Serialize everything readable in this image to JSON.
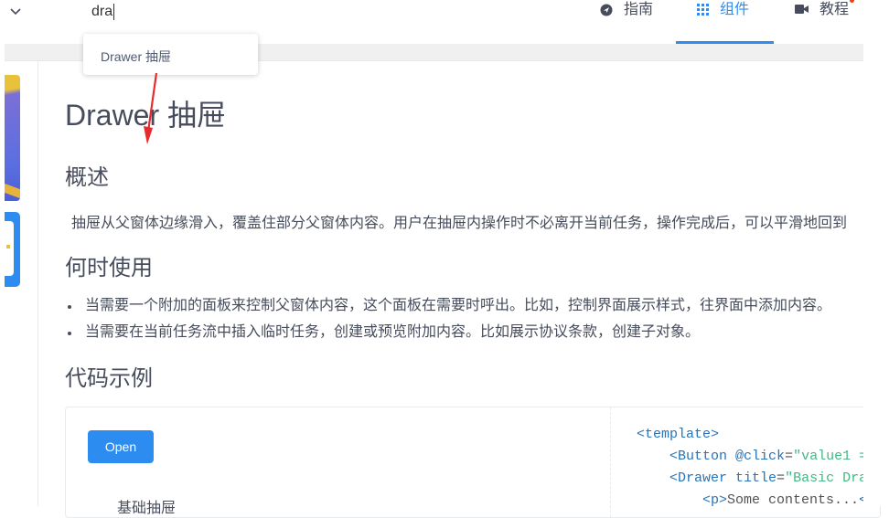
{
  "header": {
    "search_value": "dra",
    "nav": [
      {
        "label": "指南",
        "icon": "compass-icon",
        "active": false
      },
      {
        "label": "组件",
        "icon": "grid-icon",
        "active": true
      },
      {
        "label": "教程",
        "icon": "video-icon",
        "active": false
      }
    ]
  },
  "dropdown": {
    "items": [
      "Drawer 抽屉"
    ]
  },
  "content": {
    "title": "Drawer 抽屉",
    "overview_heading": "概述",
    "overview_text": "抽屉从父窗体边缘滑入，覆盖住部分父窗体内容。用户在抽屉内操作时不必离开当前任务，操作完成后，可以平滑地回到",
    "when_heading": "何时使用",
    "when_items": [
      "当需要一个附加的面板来控制父窗体内容，这个面板在需要时呼出。比如，控制界面展示样式，往界面中添加内容。",
      "当需要在当前任务流中插入临时任务，创建或预览附加内容。比如展示协议条款，创建子对象。"
    ],
    "examples_heading": "代码示例"
  },
  "demo": {
    "button_label": "Open",
    "caption": "基础抽屉",
    "code": {
      "line1": "<template>",
      "line2_tag": "<Button ",
      "line2_attr": "@click",
      "line2_eq": "=",
      "line2_str": "\"value1 =",
      "line3_tag": "<Drawer ",
      "line3_attr": "title",
      "line3_eq": "=",
      "line3_str": "\"Basic Dra",
      "line4_tag": "<p>",
      "line4_text": "Some contents...",
      "line4_end": "</"
    }
  },
  "colors": {
    "primary": "#2d8cf0",
    "text": "#464c5b",
    "arrow": "#e52b2b"
  }
}
